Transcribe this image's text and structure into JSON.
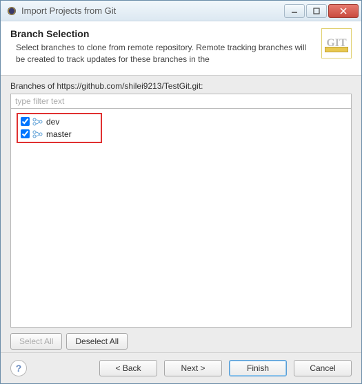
{
  "window": {
    "title": "Import Projects from Git"
  },
  "header": {
    "title": "Branch Selection",
    "desc": "Select branches to clone from remote repository. Remote tracking branches will be created to track updates for these branches in the"
  },
  "branches_label": "Branches of https://github.com/shilei9213/TestGit.git:",
  "filter": {
    "placeholder": "type filter text"
  },
  "branches": [
    {
      "name": "dev",
      "checked": true
    },
    {
      "name": "master",
      "checked": true
    }
  ],
  "buttons": {
    "select_all": "Select All",
    "deselect_all": "Deselect All",
    "back": "< Back",
    "next": "Next >",
    "finish": "Finish",
    "cancel": "Cancel"
  }
}
